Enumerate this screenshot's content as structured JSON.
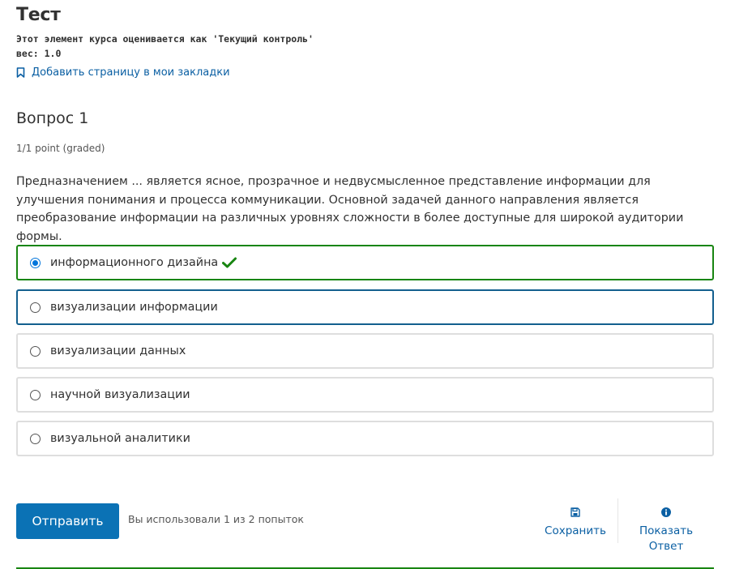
{
  "header": {
    "title": "Тест",
    "grading_type": "Этот элемент курса оценивается как 'Текущий контроль'",
    "weight": "вес: 1.0",
    "bookmark_label": "Добавить страницу в мои закладки"
  },
  "question": {
    "title": "Вопрос 1",
    "points": "1/1 point (graded)",
    "text": "Предназначением ... является ясное, прозрачное и недвусмысленное представление информации для улучшения понимания и процесса коммуникации. Основной задачей данного направления является преобразование информации на различных уровнях сложности в более доступные для широкой аудитории формы.",
    "answers": [
      {
        "label": "информационного дизайна",
        "selected": true,
        "correct": true
      },
      {
        "label": "визуализации информации",
        "selected": false
      },
      {
        "label": "визуализации данных",
        "selected": false
      },
      {
        "label": "научной визуализации",
        "selected": false
      },
      {
        "label": "визуальной аналитики",
        "selected": false
      }
    ]
  },
  "actions": {
    "submit_label": "Отправить",
    "attempts_text": "Вы использовали 1 из 2 попыток",
    "save_label": "Сохранить",
    "show_answer_label_1": "Показать",
    "show_answer_label_2": "Ответ"
  },
  "icons": {
    "bookmark": "bookmark-icon",
    "check": "check-icon",
    "save": "save-icon",
    "info": "info-icon"
  },
  "colors": {
    "correct_green": "#188511",
    "link_blue": "#0a5fa3",
    "submit_blue": "#0b72b5",
    "focus_border": "#135f8e",
    "radio_blue": "#0075db"
  }
}
